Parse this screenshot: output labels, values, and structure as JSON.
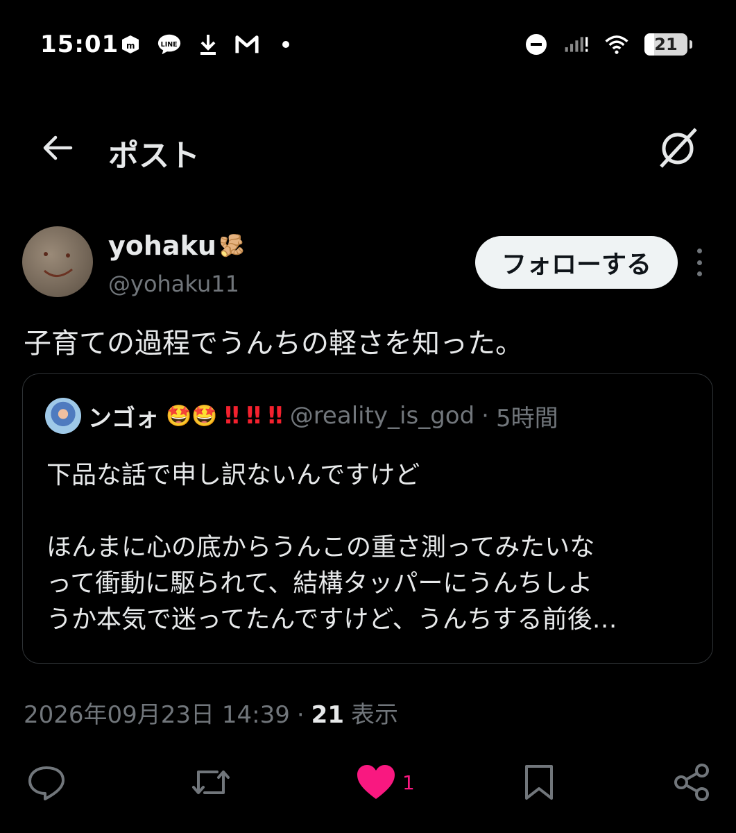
{
  "status_bar": {
    "time": "15:01",
    "battery": "21",
    "left_icons": [
      "mercari-icon",
      "line-icon",
      "download-icon",
      "gmail-icon",
      "dot-icon"
    ],
    "right_icons": [
      "dnd-icon",
      "signal-icon",
      "wifi-icon",
      "battery-icon"
    ]
  },
  "header": {
    "title": "ポスト",
    "back_icon": "arrow-left-icon",
    "grok_icon": "grok-icon"
  },
  "post": {
    "author": {
      "display_name": "yohaku",
      "name_emoji": "🫚",
      "handle": "@yohaku11"
    },
    "follow_label": "フォローする",
    "text": "子育ての過程でうんちの軽さを知った。",
    "timestamp": "2026年09月23日 14:39",
    "separator": "·",
    "views": "21",
    "views_label": "表示"
  },
  "quote": {
    "name": "ンゴォ",
    "name_emojis": "🤩🤩",
    "bangs": [
      "‼",
      "‼",
      "‼"
    ],
    "handle": "@reality_is_god",
    "dot": "·",
    "time_ago": "5時間",
    "line1": "下品な話で申し訳ないんですけど",
    "line2": "ほんまに心の底からうんこの重さ測ってみたいな",
    "line3": "って衝動に駆られて、結構タッパーにうんちしよ",
    "line4": "うか本気で迷ってたんですけど、うんちする前後…"
  },
  "actions": {
    "like_count": "1",
    "colors": {
      "like": "#f91880",
      "icon": "#71767b"
    }
  }
}
